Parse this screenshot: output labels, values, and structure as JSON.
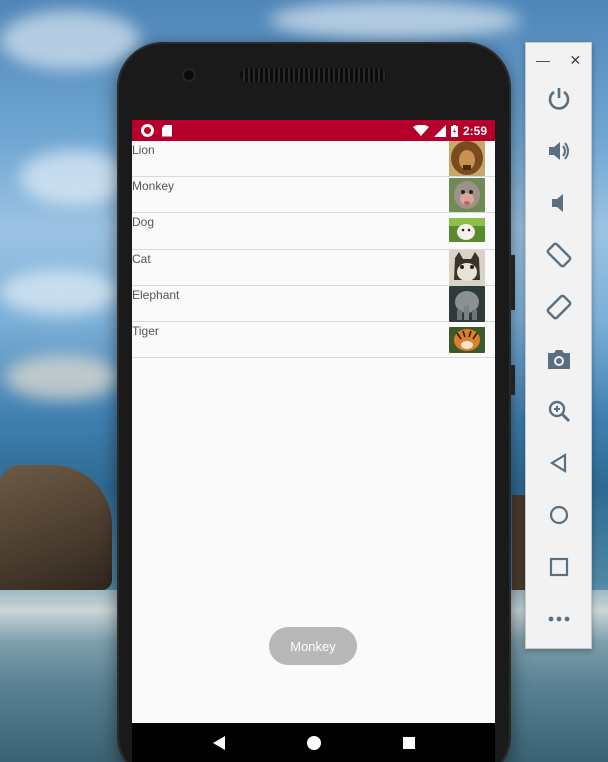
{
  "statusbar": {
    "time": "2:59"
  },
  "list": {
    "items": [
      {
        "label": "Lion",
        "icon": "lion-photo"
      },
      {
        "label": "Monkey",
        "icon": "monkey-photo"
      },
      {
        "label": "Dog",
        "icon": "dog-photo"
      },
      {
        "label": "Cat",
        "icon": "cat-photo"
      },
      {
        "label": "Elephant",
        "icon": "elephant-photo"
      },
      {
        "label": "Tiger",
        "icon": "tiger-photo"
      }
    ]
  },
  "toast": {
    "text": "Monkey"
  },
  "colors": {
    "statusbar": "#b5002b",
    "background": "#fafafa",
    "divider": "#d8d8d8",
    "toast": "#b8b8b8",
    "navbar": "#000000"
  },
  "emulator_toolbar": {
    "window_controls": [
      "minimize-icon",
      "close-icon"
    ],
    "buttons": [
      "power-icon",
      "volume-up-icon",
      "volume-down-icon",
      "rotate-left-icon",
      "rotate-right-icon",
      "camera-icon",
      "zoom-icon",
      "back-icon",
      "home-icon",
      "overview-icon",
      "more-icon"
    ]
  }
}
